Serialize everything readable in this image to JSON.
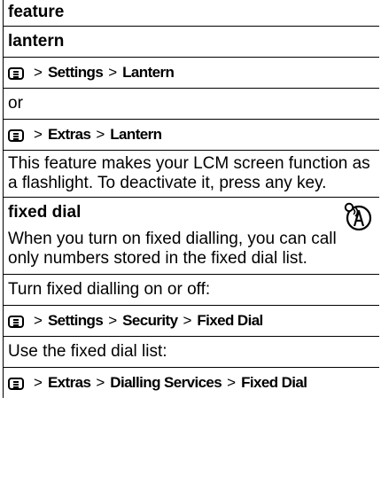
{
  "header": {
    "label": "feature"
  },
  "lantern": {
    "title": "lantern",
    "path1": [
      "Settings",
      "Lantern"
    ],
    "or": "or",
    "path2": [
      "Extras",
      "Lantern"
    ],
    "description": "This feature makes your LCM screen function as a flashlight. To deactivate it, press any key."
  },
  "fixed_dial": {
    "title": "fixed dial",
    "intro": "When you turn on fixed dialling, you can call only numbers stored in the fixed dial list.",
    "toggle_label": "Turn fixed dialling on or off:",
    "path1": [
      "Settings",
      "Security",
      "Fixed Dial"
    ],
    "use_label": "Use the fixed dial list:",
    "path2": [
      "Extras",
      "Dialling Services",
      "Fixed Dial"
    ]
  },
  "symbols": {
    "separator": ">"
  },
  "icons": {
    "menu": "menu-key-icon",
    "network": "network-dependent-feature-icon"
  }
}
